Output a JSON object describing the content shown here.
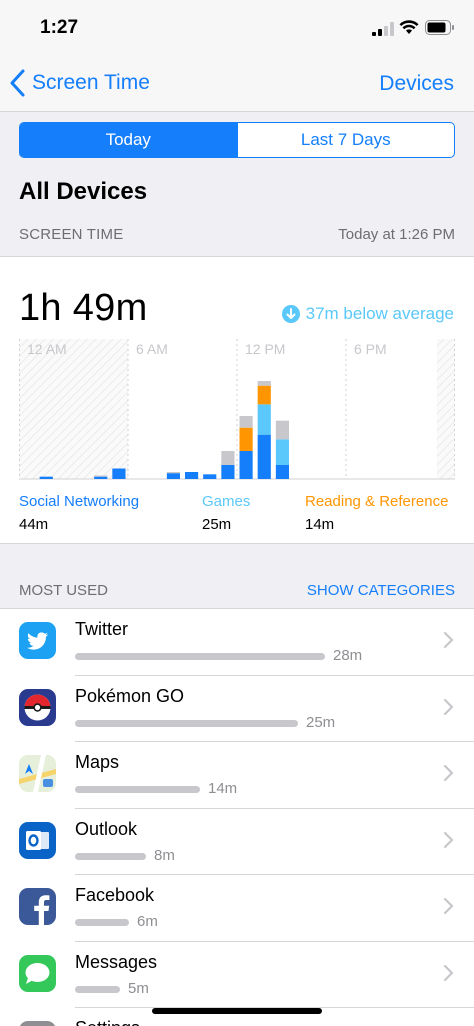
{
  "status_bar": {
    "time": "1:27"
  },
  "nav": {
    "back_label": "Screen Time",
    "right_label": "Devices"
  },
  "segment": {
    "today": "Today",
    "last7": "Last 7 Days",
    "selected": "Today"
  },
  "title": "All Devices",
  "screen_time": {
    "header": "SCREEN TIME",
    "updated": "Today at 1:26 PM",
    "total": "1h 49m",
    "average": "37m below average"
  },
  "chart_data": {
    "type": "bar",
    "stacked": true,
    "x_tick_labels": [
      "12 AM",
      "6 AM",
      "12 PM",
      "6 PM"
    ],
    "hours": [
      0,
      1,
      2,
      3,
      4,
      5,
      6,
      7,
      8,
      9,
      10,
      11,
      12,
      13,
      14,
      15,
      16,
      17,
      18,
      19,
      20,
      21,
      22,
      23
    ],
    "series": [
      {
        "name": "Social Networking",
        "color": "#147efb",
        "values": [
          0,
          1,
          0,
          0,
          1,
          4.5,
          0,
          0,
          2.5,
          3,
          2,
          6,
          12,
          19,
          6,
          0,
          0,
          0,
          0,
          0,
          0,
          0,
          0,
          0
        ]
      },
      {
        "name": "Games",
        "color": "#5ac8fa",
        "values": [
          0,
          0,
          0,
          0,
          0,
          0,
          0,
          0,
          0,
          0,
          0,
          0,
          0,
          13,
          11,
          0,
          0,
          0,
          0,
          0,
          0,
          0,
          0,
          0
        ]
      },
      {
        "name": "Reading & Reference",
        "color": "#ff9500",
        "values": [
          0,
          0,
          0,
          0,
          0,
          0,
          0,
          0,
          0,
          0,
          0,
          0,
          10,
          8,
          0,
          0,
          0,
          0,
          0,
          0,
          0,
          0,
          0,
          0
        ]
      },
      {
        "name": "Other",
        "color": "#c7c7cc",
        "values": [
          0,
          0,
          0,
          0,
          0.5,
          0,
          0,
          0,
          0.5,
          0,
          0,
          6,
          5,
          2,
          8,
          0,
          0,
          0,
          0,
          0,
          0,
          0,
          0,
          0
        ]
      }
    ],
    "ylim": [
      0,
      60
    ],
    "shaded_hours": [
      [
        0,
        6
      ],
      [
        23,
        24
      ]
    ]
  },
  "legend": [
    {
      "name": "Social Networking",
      "value": "44m",
      "color": "#147efb"
    },
    {
      "name": "Games",
      "value": "25m",
      "color": "#5ac8fa"
    },
    {
      "name": "Reading & Reference",
      "value": "14m",
      "color": "#ff9500"
    }
  ],
  "most_used": {
    "header": "MOST USED",
    "action": "SHOW CATEGORIES",
    "apps": [
      {
        "name": "Twitter",
        "duration": "28m",
        "minutes": 28,
        "icon": "twitter-icon"
      },
      {
        "name": "Pokémon GO",
        "duration": "25m",
        "minutes": 25,
        "icon": "pokeball-icon"
      },
      {
        "name": "Maps",
        "duration": "14m",
        "minutes": 14,
        "icon": "maps-icon"
      },
      {
        "name": "Outlook",
        "duration": "8m",
        "minutes": 8,
        "icon": "outlook-icon"
      },
      {
        "name": "Facebook",
        "duration": "6m",
        "minutes": 6,
        "icon": "facebook-icon"
      },
      {
        "name": "Messages",
        "duration": "5m",
        "minutes": 5,
        "icon": "messages-icon"
      },
      {
        "name": "Settings",
        "duration": "",
        "minutes": 0,
        "icon": "settings-icon"
      }
    ]
  }
}
